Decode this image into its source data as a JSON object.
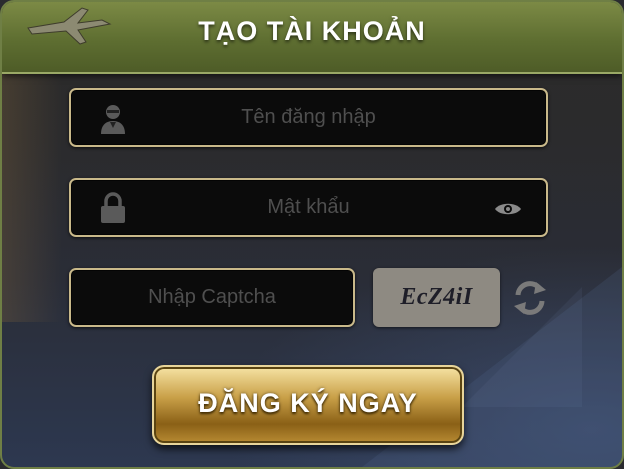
{
  "header": {
    "title": "TẠO TÀI KHOẢN"
  },
  "form": {
    "username": {
      "placeholder": "Tên đăng nhập",
      "value": "",
      "icon": "user-icon"
    },
    "password": {
      "placeholder": "Mật khẩu",
      "value": "",
      "icon": "lock-icon",
      "toggle_icon": "eye-icon"
    },
    "captcha": {
      "placeholder": "Nhập Captcha",
      "value": "",
      "code": "EcZ4iI",
      "refresh_icon": "refresh-icon"
    },
    "submit_label": "ĐĂNG KÝ NGAY"
  },
  "colors": {
    "header_green": "#6a7a3a",
    "field_border": "#c9b98a",
    "button_gold": "#c9a048"
  }
}
